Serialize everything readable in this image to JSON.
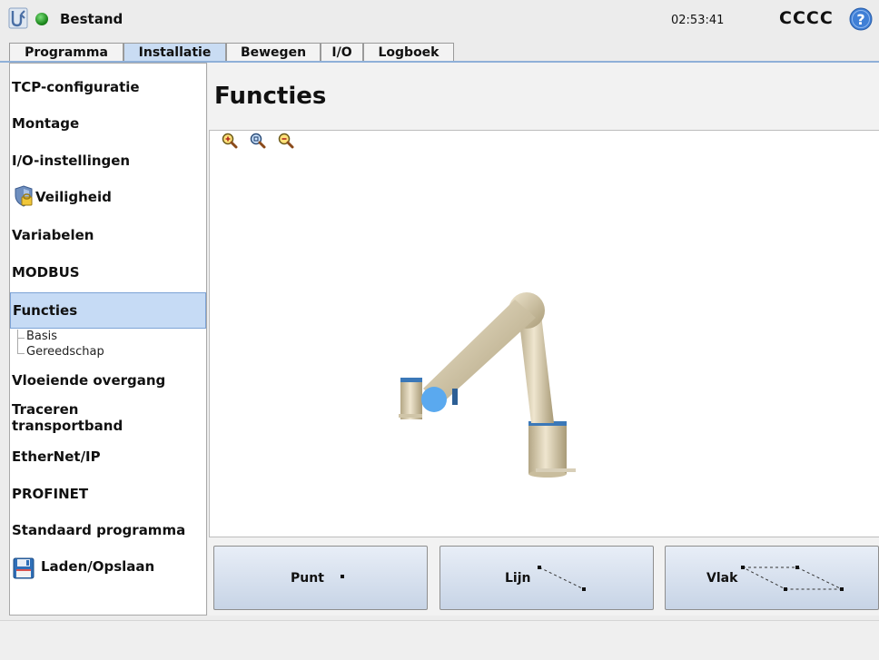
{
  "header": {
    "app_name": "Bestand",
    "time": "02:53:41",
    "robot_name": "CCCC",
    "status_color": "#2a9d2a",
    "icons": [
      "ur-logo-icon",
      "status-dot-icon",
      "help-icon"
    ]
  },
  "tabs": [
    {
      "label": "Programma",
      "active": false
    },
    {
      "label": "Installatie",
      "active": true
    },
    {
      "label": "Bewegen",
      "active": false
    },
    {
      "label": "I/O",
      "active": false
    },
    {
      "label": "Logboek",
      "active": false
    }
  ],
  "sidebar": {
    "items": [
      {
        "label": "TCP-configuratie"
      },
      {
        "label": "Montage"
      },
      {
        "label": "I/O-instellingen"
      },
      {
        "label": "Veiligheid",
        "icon": "safety-shield-icon"
      },
      {
        "label": "Variabelen"
      },
      {
        "label": "MODBUS"
      },
      {
        "label": "Functies",
        "selected": true
      },
      {
        "label": "Vloeiende overgang"
      },
      {
        "label": "Traceren",
        "label2": "transportband"
      },
      {
        "label": "EtherNet/IP"
      },
      {
        "label": "PROFINET"
      },
      {
        "label": "Standaard programma"
      },
      {
        "label": "Laden/Opslaan",
        "icon": "save-disk-icon"
      }
    ],
    "subitems": [
      {
        "label": "Basis"
      },
      {
        "label": "Gereedschap"
      }
    ]
  },
  "main": {
    "title": "Functies",
    "zoom_icons": [
      "zoom-in-icon",
      "zoom-reset-icon",
      "zoom-out-icon"
    ],
    "buttons": [
      {
        "label": "Punt",
        "icon": "point-icon"
      },
      {
        "label": "Lijn",
        "icon": "line-icon"
      },
      {
        "label": "Vlak",
        "icon": "plane-icon"
      }
    ]
  },
  "colors": {
    "selected_bg": "#c6dbf5",
    "active_tab": "#c9dcf3",
    "button_bg": "#d6e0ee",
    "robot_body": "#d9ccab",
    "robot_ring": "#3b78b8",
    "tcp_marker": "#5aa9ef"
  }
}
